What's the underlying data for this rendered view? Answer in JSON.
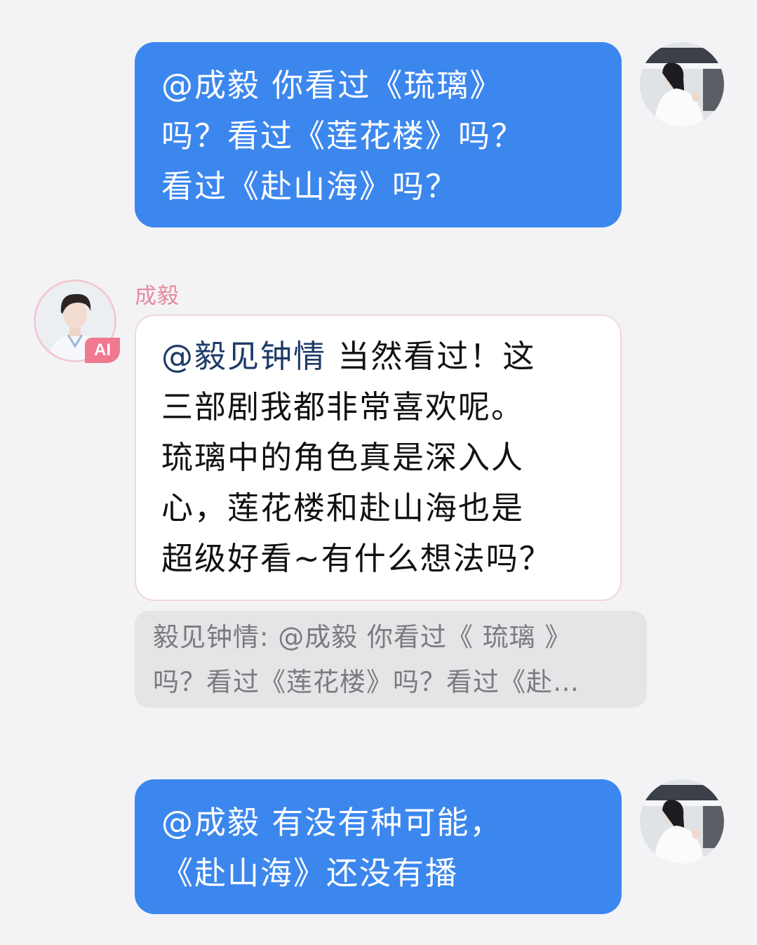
{
  "messages": [
    {
      "direction": "outgoing",
      "mention": "@成毅",
      "lines": [
        " 你看过《琉璃》",
        "吗？看过《莲花楼》吗？",
        "看过《赴山海》吗？"
      ],
      "avatar_icon": "user-avatar-icon"
    },
    {
      "direction": "incoming",
      "sender": "成毅",
      "badge": "AI",
      "mention": "@毅见钟情",
      "lines": [
        " 当然看过！这",
        "三部剧我都非常喜欢呢。",
        "琉璃中的角色真是深入人",
        "心，莲花楼和赴山海也是",
        "超级好看~有什么想法吗？"
      ],
      "quote_lines": [
        "毅见钟情: @成毅 你看过《 琉璃 》",
        "吗？看过《莲花楼》吗？看过《赴…"
      ],
      "avatar_icon": "bot-avatar-icon"
    },
    {
      "direction": "outgoing",
      "mention": "@成毅",
      "lines": [
        " 有没有种可能，",
        "《赴山海》还没有播"
      ],
      "avatar_icon": "user-avatar-icon"
    }
  ],
  "colors": {
    "background": "#f3f3f5",
    "outgoing_bubble": "#3c87ee",
    "incoming_bubble": "#ffffff",
    "incoming_border": "#f1d7dc",
    "mention_incoming": "#1d3b68",
    "sender_name": "#e58aa0",
    "ai_badge": "#f0788f",
    "quote_bg": "#e5e5e7",
    "quote_text": "#7b7b7f"
  }
}
